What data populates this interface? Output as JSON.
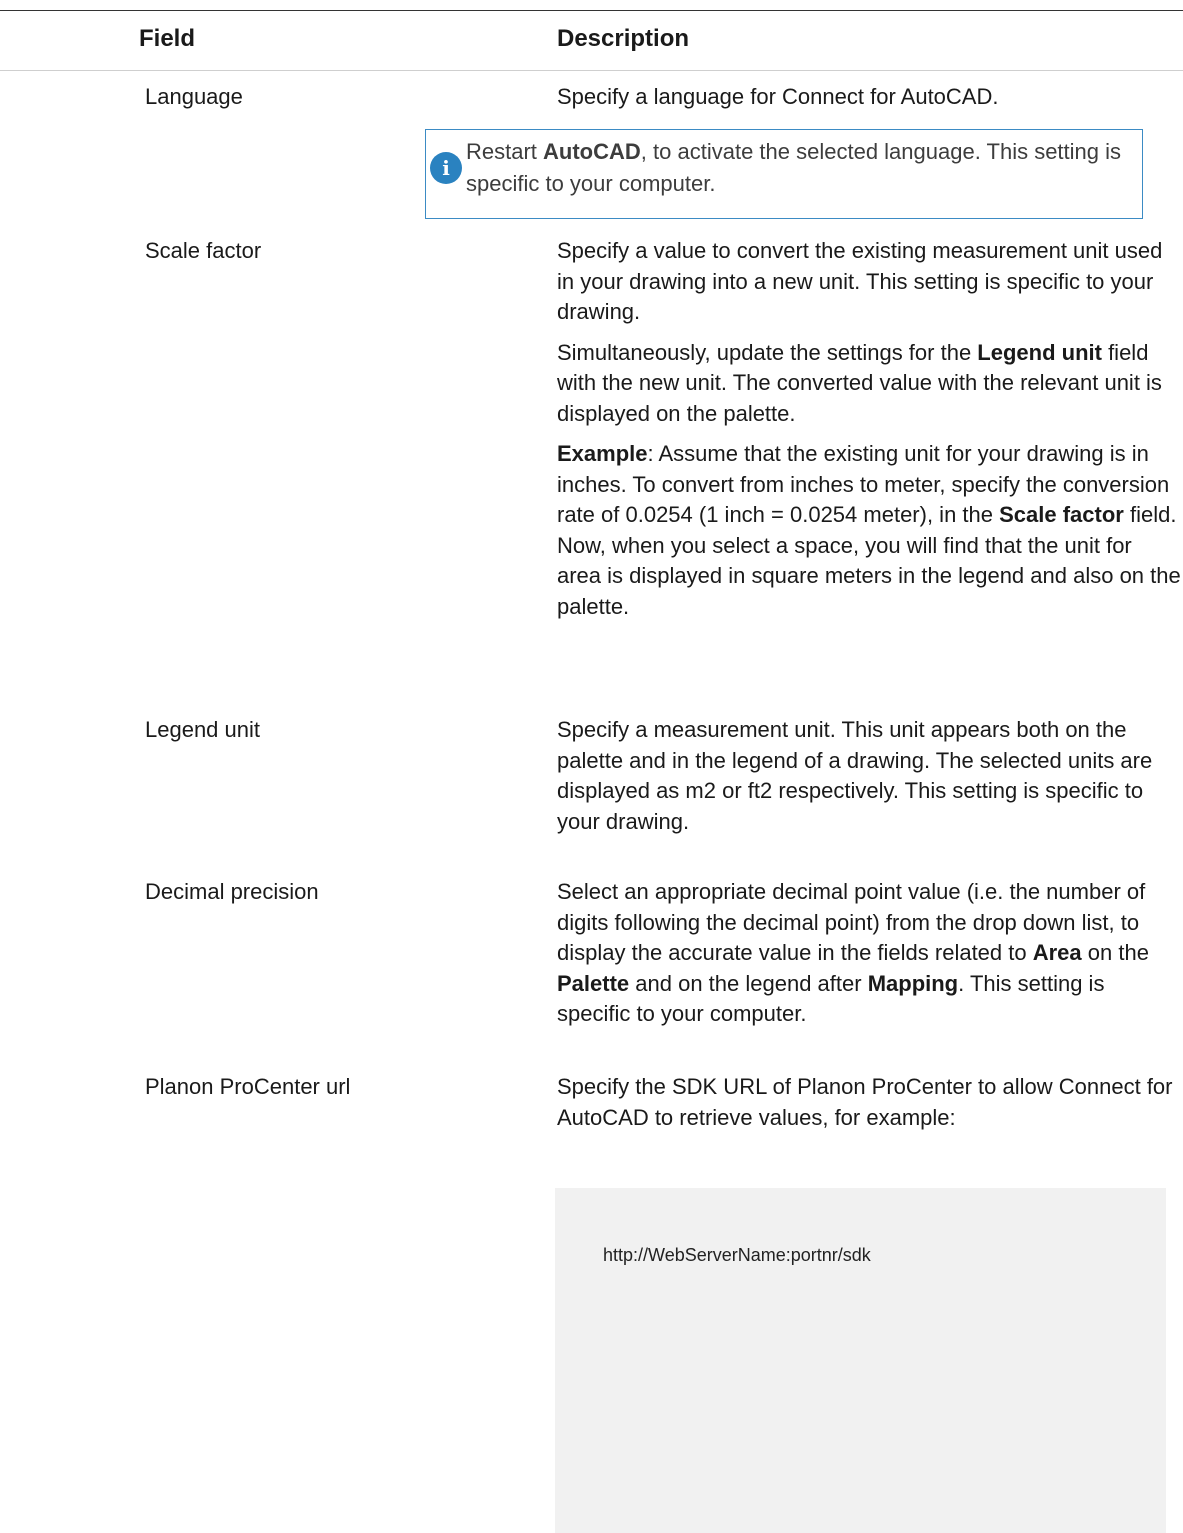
{
  "table": {
    "headers": {
      "field": "Field",
      "description": "Description"
    },
    "rows": [
      {
        "field": "Language",
        "description": [
          "Specify a language for Connect for AutoCAD."
        ],
        "note": {
          "icon": "info-icon",
          "icon_glyph": "i",
          "parts": [
            "Restart ",
            "AutoCAD",
            ", to activate the selected language. This setting is specific to your computer."
          ]
        }
      },
      {
        "field": "Scale factor",
        "paragraphs": [
          {
            "parts": [
              "Specify a value to convert the existing measurement unit used in your drawing into a new unit. This setting is specific to your drawing."
            ]
          },
          {
            "parts": [
              "Simultaneously, update the settings for the ",
              "Legend unit",
              " field with the new unit. The converted value with the relevant unit is displayed on the palette."
            ]
          },
          {
            "parts": [
              "Example",
              ": Assume that the existing unit for your drawing is in inches. To convert from inches to meter, specify the conversion rate of 0.0254 (1 inch = 0.0254 meter), in the ",
              "Scale factor",
              " field. Now, when you select a space, you will find that the unit for area is displayed in square meters in the legend and also on the palette."
            ]
          }
        ]
      },
      {
        "field": "Legend unit",
        "paragraphs": [
          {
            "parts": [
              "Specify a measurement unit. This unit appears both on the palette and in the legend of a drawing. The selected units are displayed as m2 or ft2 respectively. This setting is specific to your drawing."
            ]
          }
        ]
      },
      {
        "field": "Decimal precision",
        "paragraphs": [
          {
            "parts": [
              "Select an appropriate decimal point value (i.e. the number of digits following the decimal point) from the drop down list, to display the accurate value in the fields related to ",
              "Area",
              " on the ",
              "Palette",
              " and on the legend after ",
              "Mapping",
              ". This setting is specific to your computer."
            ]
          }
        ]
      },
      {
        "field": "Planon ProCenter url",
        "paragraphs": [
          {
            "parts": [
              "Specify the SDK URL of Planon ProCenter to allow Connect for AutoCAD to retrieve values, for example:"
            ]
          }
        ],
        "code": "http://WebServerName:portnr/sdk"
      }
    ]
  }
}
